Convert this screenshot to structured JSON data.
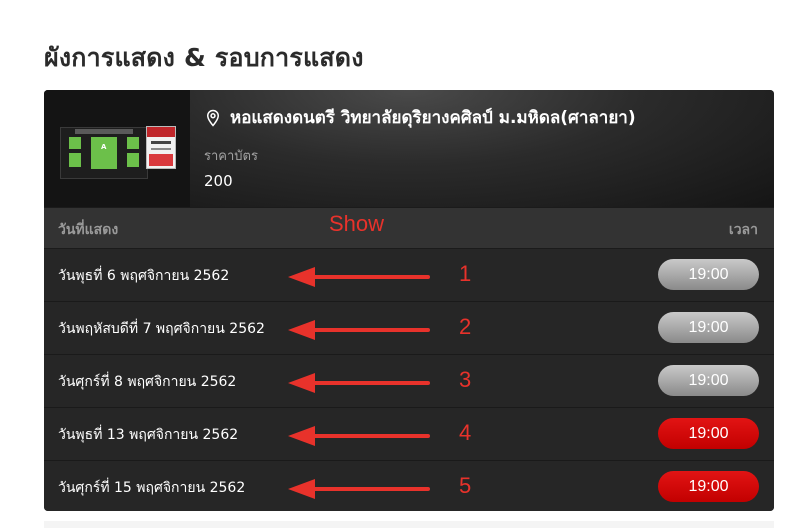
{
  "section": {
    "title": "ผังการแสดง & รอบการแสดง"
  },
  "venue": {
    "name": "หอแสดงดนตรี วิทยาลัยดุริยางคศิลป์ ม.มหิดล(ศาลายา)",
    "pin_icon": "location-pin-icon",
    "price_label": "ราคาบัตร",
    "price_value": "200",
    "thumbnail": {
      "seatmap_block_label": "A",
      "seatmap_color": "#6cc04a"
    }
  },
  "table": {
    "date_header": "วันที่แสดง",
    "time_header": "เวลา",
    "annotation_label": "Show",
    "rows": [
      {
        "date": "วันพุธที่ 6 พฤศจิกายน 2562",
        "time": "19:00",
        "status": "disabled",
        "annotation": "1"
      },
      {
        "date": "วันพฤหัสบดีที่ 7 พฤศจิกายน 2562",
        "time": "19:00",
        "status": "disabled",
        "annotation": "2"
      },
      {
        "date": "วันศุกร์ที่ 8 พฤศจิกายน 2562",
        "time": "19:00",
        "status": "disabled",
        "annotation": "3"
      },
      {
        "date": "วันพุธที่ 13 พฤศจิกายน 2562",
        "time": "19:00",
        "status": "active",
        "annotation": "4"
      },
      {
        "date": "วันศุกร์ที่ 15 พฤศจิกายน 2562",
        "time": "19:00",
        "status": "active",
        "annotation": "5"
      }
    ]
  },
  "colors": {
    "annotation": "#e8322b",
    "active_time": "#d40a0a",
    "disabled_time": "#a9a9a9",
    "card_bg": "#262626"
  }
}
